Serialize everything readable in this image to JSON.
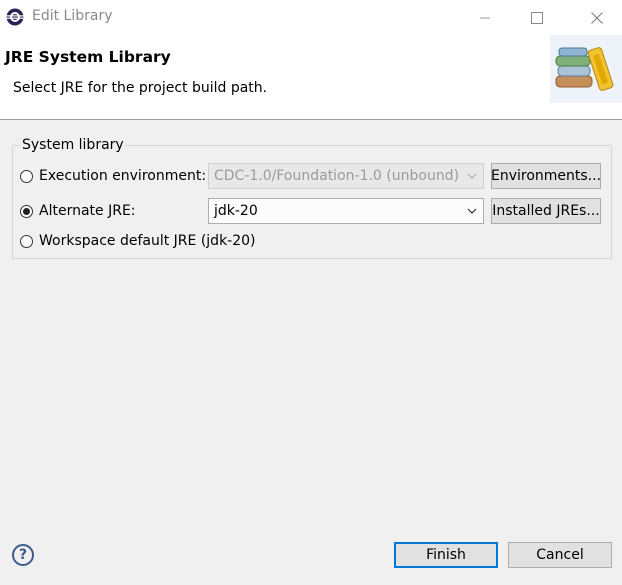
{
  "window": {
    "title": "Edit Library",
    "minimize_icon": "minimize-icon",
    "maximize_icon": "maximize-icon",
    "close_icon": "close-icon"
  },
  "header": {
    "title": "JRE System Library",
    "description": "Select JRE for the project build path.",
    "image_icon": "library-books-icon"
  },
  "group": {
    "label": "System library",
    "options": [
      {
        "label": "Execution environment:",
        "selected": false,
        "combo_value": "CDC-1.0/Foundation-1.0 (unbound)",
        "combo_enabled": false,
        "button_label": "Environments..."
      },
      {
        "label": "Alternate JRE:",
        "selected": true,
        "combo_value": "jdk-20",
        "combo_enabled": true,
        "button_label": "Installed JREs..."
      },
      {
        "label": "Workspace default JRE (jdk-20)",
        "selected": false
      }
    ]
  },
  "footer": {
    "help_symbol": "?",
    "finish_label": "Finish",
    "cancel_label": "Cancel"
  },
  "colors": {
    "accent": "#0078d7",
    "dialog_bg": "#f0f0f0",
    "header_bg": "#ffffff"
  }
}
